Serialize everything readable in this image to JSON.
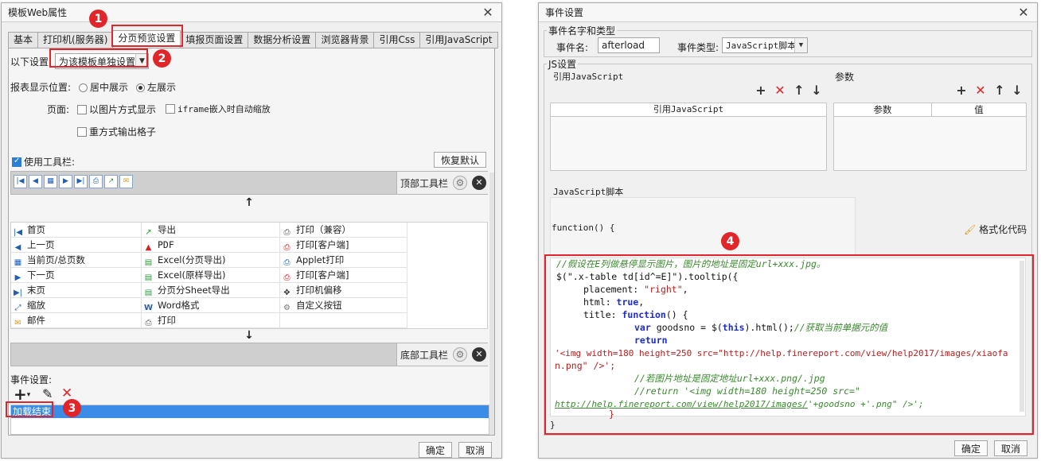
{
  "left": {
    "title": "模板Web属性",
    "tabs": [
      "基本",
      "打印机(服务器)",
      "分页预览设置",
      "填报页面设置",
      "数据分析设置",
      "浏览器背景",
      "引用Css",
      "引用JavaScript"
    ],
    "settings_label": "以下设置:",
    "settings_value": "为该模板单独设置",
    "report_pos_label": "报表显示位置:",
    "pos_center": "居中展示",
    "pos_left": "左展示",
    "page_label": "页面:",
    "opt_image": "以图片方式显示",
    "opt_iframe": "iframe嵌入时自动缩放",
    "opt_reprint": "重方式输出格子",
    "use_toolbar": "使用工具栏:",
    "restore_default": "恢复默认",
    "top_toolbar": "顶部工具栏",
    "bottom_toolbar": "底部工具栏",
    "up_arrow": "↑",
    "down_arrow": "↓",
    "buttons_col1": [
      "首页",
      "上一页",
      "当前页/总页数",
      "下一页",
      "末页",
      "缩放",
      "邮件"
    ],
    "buttons_col2": [
      "导出",
      "PDF",
      "Excel(分页导出)",
      "Excel(原样导出)",
      "分页分Sheet导出",
      "Word格式",
      "打印"
    ],
    "buttons_col3": [
      "打印（兼容）",
      "打印[客户端]",
      "Applet打印",
      "打印[客户端]",
      "打印机偏移",
      "自定义按钮"
    ],
    "event_label": "事件设置:",
    "event_item": "加载结束",
    "ok": "确定",
    "cancel": "取消"
  },
  "right": {
    "title": "事件设置",
    "group_event": "事件名字和类型",
    "event_name_label": "事件名:",
    "event_name_value": "afterload",
    "event_type_label": "事件类型:",
    "event_type_value": "JavaScript脚本",
    "group_js": "JS设置",
    "ref_js_label": "引用JavaScript",
    "ref_js_col": "引用JavaScript",
    "param_label": "参数",
    "param_col": "参数",
    "value_col": "值",
    "script_label": "JavaScript脚本",
    "func_decl": "function() {",
    "format_code": "格式化代码",
    "close_brace": "}",
    "ok": "确定",
    "cancel": "取消",
    "code": {
      "l1": "//假设在E列做悬停显示图片，图片的地址是固定url+xxx.jpg。",
      "l2a": "$(\".x-table td[id^=E]\").tooltip({",
      "l3a": "placement: ",
      "l3b": "\"right\"",
      "l3c": ",",
      "l4a": "html: ",
      "l4b": "true",
      "l4c": ",",
      "l5a": "title: ",
      "l5b": "function",
      "l5c": "() {",
      "l6a": "var",
      "l6b": " goodsno = $(",
      "l6c": "this",
      "l6d": ").html();",
      "l6e": "//获取当前单据元的值",
      "l7": "return",
      "l8": "'<img width=180 height=250 src=\"http://help.finereport.com/view/help2017/images/xiaofa",
      "l9": "n.png\" />';",
      "l10": "//若图片地址是固定地址url+xxx.png/.jpg",
      "l11": "//return '<img width=180 height=250 src=\"",
      "l12a": "http://help.finereport.com/view/help2017/images/",
      "l12b": "'+goodsno +'.png\" />';",
      "l13": "}"
    }
  },
  "annotations": [
    "1",
    "2",
    "3",
    "4"
  ],
  "colors": {
    "highlight": "#e0262b",
    "selection": "#3b8ce6"
  }
}
